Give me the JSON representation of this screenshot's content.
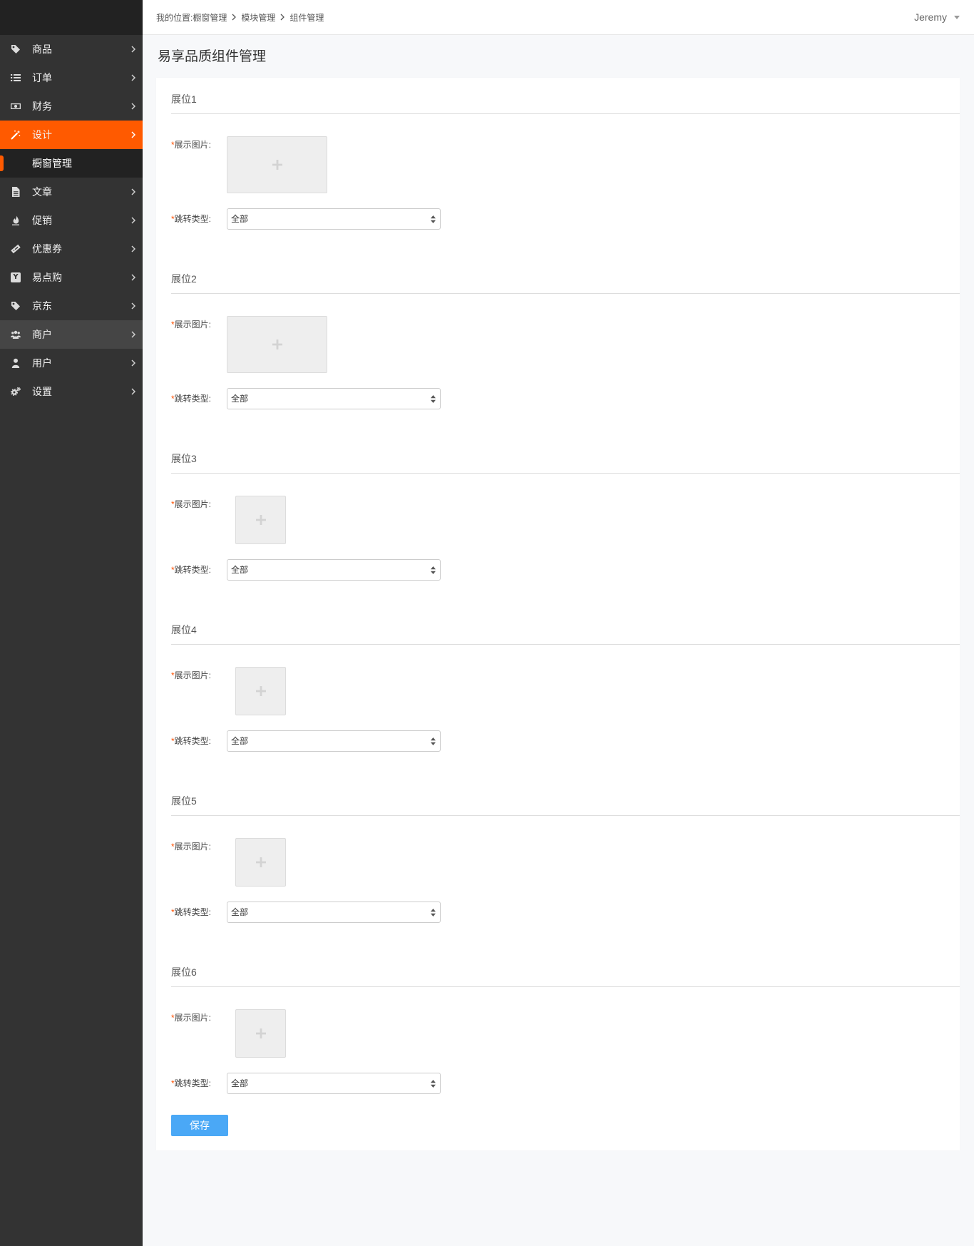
{
  "sidebar": {
    "items": [
      {
        "label": "商品",
        "icon": "tag-icon"
      },
      {
        "label": "订单",
        "icon": "list-icon"
      },
      {
        "label": "财务",
        "icon": "money-icon"
      },
      {
        "label": "设计",
        "icon": "magic-wand-icon",
        "active": true,
        "expanded": true,
        "children": [
          {
            "label": "橱窗管理",
            "selected": true
          }
        ]
      },
      {
        "label": "文章",
        "icon": "document-icon"
      },
      {
        "label": "促销",
        "icon": "fire-icon"
      },
      {
        "label": "优惠券",
        "icon": "ticket-icon"
      },
      {
        "label": "易点购",
        "icon": "y-badge-icon",
        "icon_letter": "Y"
      },
      {
        "label": "京东",
        "icon": "tag-icon"
      },
      {
        "label": "商户",
        "icon": "users-icon",
        "highlighted": true
      },
      {
        "label": "用户",
        "icon": "user-icon"
      },
      {
        "label": "设置",
        "icon": "gears-icon"
      }
    ]
  },
  "header": {
    "breadcrumb_prefix": "我的位置:",
    "breadcrumb": [
      "橱窗管理",
      "模块管理",
      "组件管理"
    ],
    "user_name": "Jeremy"
  },
  "page": {
    "title": "易享品质组件管理"
  },
  "form": {
    "required_mark": "*",
    "slots": [
      {
        "title": "展位1",
        "image_label": "展示图片:",
        "jump_type_label": "跳转类型:",
        "jump_type_value": "全部"
      },
      {
        "title": "展位2",
        "image_label": "展示图片:",
        "jump_type_label": "跳转类型:",
        "jump_type_value": "全部"
      },
      {
        "title": "展位3",
        "image_label": "展示图片:",
        "jump_type_label": "跳转类型:",
        "jump_type_value": "全部"
      },
      {
        "title": "展位4",
        "image_label": "展示图片:",
        "jump_type_label": "跳转类型:",
        "jump_type_value": "全部"
      },
      {
        "title": "展位5",
        "image_label": "展示图片:",
        "jump_type_label": "跳转类型:",
        "jump_type_value": "全部"
      },
      {
        "title": "展位6",
        "image_label": "展示图片:",
        "jump_type_label": "跳转类型:",
        "jump_type_value": "全部"
      }
    ],
    "save_label": "保存"
  },
  "colors": {
    "accent": "#ff5a00",
    "sidebar_bg": "#333333",
    "save_button": "#4aa8f6",
    "required_mark": "#ff5000",
    "page_bg": "#f7f8fa"
  }
}
